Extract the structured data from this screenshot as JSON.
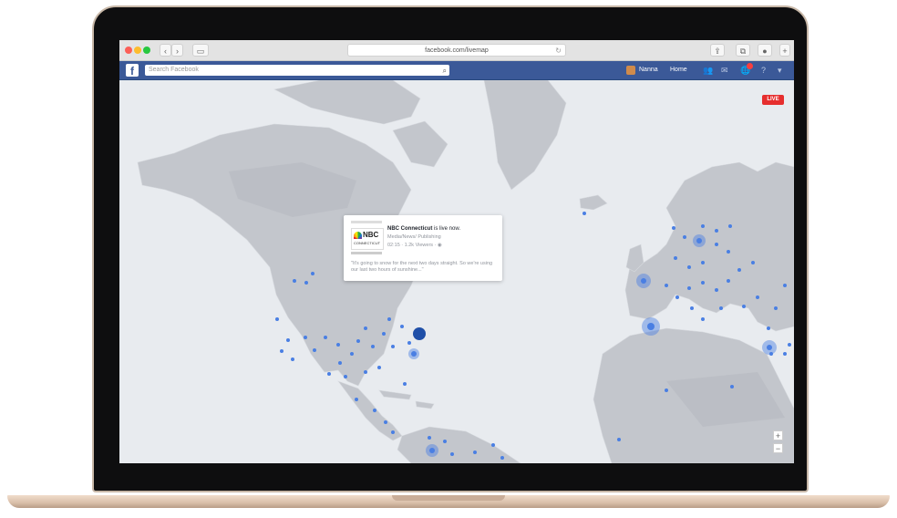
{
  "browser": {
    "url": "facebook.com/livemap",
    "back_icon": "‹",
    "forward_icon": "›",
    "sidebar_icon": "▭",
    "reload_icon": "↻",
    "share_icon": "⇪",
    "tabs_icon": "⧉",
    "extension_icon": "●",
    "add_icon": "+"
  },
  "fb": {
    "logo": "f",
    "search_placeholder": "Search Facebook",
    "search_icon": "⌕",
    "user_name": "Nanna",
    "home_label": "Home",
    "friends_icon": "👥",
    "messages_icon": "✉",
    "notifications_icon": "🌐",
    "help_icon": "?",
    "menu_icon": "▾"
  },
  "map": {
    "live_label": "LIVE",
    "zoom_in": "+",
    "zoom_out": "−",
    "colors": {
      "ocean": "#e8ebef",
      "land": "#c3c6cc",
      "land_dark": "#b5b9c0",
      "dot": "#4a7fe3",
      "dot_dark": "#1f4fa8"
    }
  },
  "popup": {
    "logo_text": "NBC",
    "logo_subtext": "CONNECTICUT",
    "title_bold": "NBC Connecticut",
    "title_rest": " is live now.",
    "publisher": "Media/News/ Publishing",
    "stats": "02:15 · 1.2k Viewers · ◉",
    "description": "\"It's going to snow for the next two days straight. So we're using our last two hours of sunshine...\""
  }
}
